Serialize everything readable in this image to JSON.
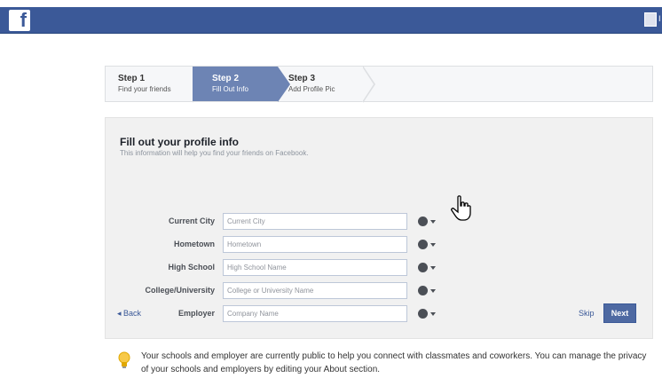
{
  "header": {
    "logo_letter": "f",
    "user_name": "I"
  },
  "steps": [
    {
      "title": "Step 1",
      "subtitle": "Find your friends"
    },
    {
      "title": "Step 2",
      "subtitle": "Fill Out Info"
    },
    {
      "title": "Step 3",
      "subtitle": "Add Profile Pic"
    }
  ],
  "panel": {
    "title": "Fill out your profile info",
    "subtitle": "This information will help you find your friends on Facebook."
  },
  "fields": [
    {
      "label": "Current City",
      "placeholder": "Current City"
    },
    {
      "label": "Hometown",
      "placeholder": "Hometown"
    },
    {
      "label": "High School",
      "placeholder": "High School Name"
    },
    {
      "label": "College/University",
      "placeholder": "College or University Name"
    },
    {
      "label": "Employer",
      "placeholder": "Company Name"
    }
  ],
  "actions": {
    "back_label": "◂ Back",
    "skip_label": "Skip",
    "next_label": "Next"
  },
  "notice": {
    "text": "Your schools and employer are currently public to help you connect with classmates and coworkers. You can manage the privacy of your schools and employers by editing your About section."
  },
  "colors": {
    "brand": "#3b5998",
    "step_active": "#6d84b4",
    "button": "#4e69a2"
  }
}
